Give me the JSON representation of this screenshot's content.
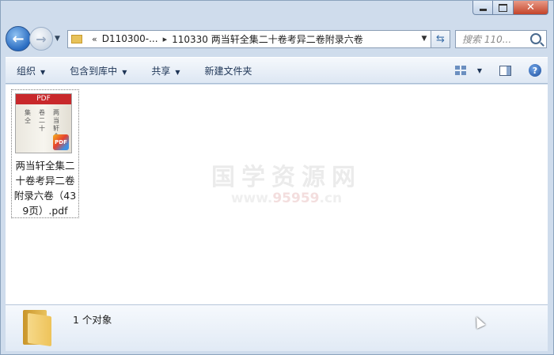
{
  "window": {
    "caption_buttons": {
      "minimize_icon": "minimize-icon",
      "maximize_icon": "maximize-icon",
      "close_glyph": "✕"
    }
  },
  "nav": {
    "back_glyph": "←",
    "forward_glyph": "→",
    "history_glyph": "▼",
    "breadcrumb_overflow": "«",
    "crumbs": [
      "D110300-...",
      "110330 两当轩全集二十卷考异二卷附录六卷"
    ],
    "crumb_sep": "▸",
    "address_dropdown_glyph": "▼",
    "refresh_glyph": "⇆",
    "search_placeholder": "搜索 110..."
  },
  "toolbar": {
    "organize": "组织",
    "include_in_library": "包含到库中",
    "share": "共享",
    "new_folder": "新建文件夹",
    "dropdown_glyph": "▼",
    "help_glyph": "?"
  },
  "files": [
    {
      "name": "两当轩全集二十卷考异二卷附录六卷（439页）.pdf",
      "thumb_band": "PDF",
      "thumb_cols": [
        "两当轩全",
        "卷二十",
        "集仝"
      ],
      "badge": "PDF"
    }
  ],
  "watermark": {
    "cn": "国学资源网",
    "url_a": "www.",
    "url_b": "95959",
    "url_c": ".cn"
  },
  "status": {
    "text": "1 个对象"
  },
  "colors": {
    "frame": "#cfdcec",
    "toolbar_text": "#1e3556",
    "pdf_band": "#c8282b"
  }
}
